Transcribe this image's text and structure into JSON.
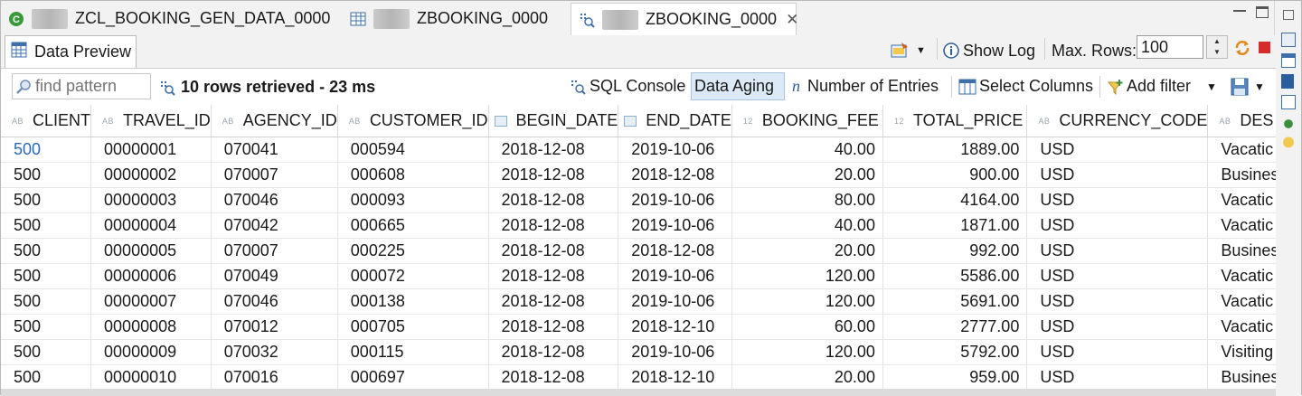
{
  "editor_tabs": [
    {
      "label": "ZCL_BOOKING_GEN_DATA_0000",
      "icon": "class-icon"
    },
    {
      "label": "ZBOOKING_0000",
      "icon": "table-icon"
    },
    {
      "label": "ZBOOKING_0000",
      "icon": "data-preview-icon"
    }
  ],
  "view": {
    "tab_label": "Data Preview",
    "show_log": "Show Log",
    "max_rows_label": "Max. Rows:",
    "max_rows_value": "100"
  },
  "toolbar": {
    "search_placeholder": "find pattern",
    "rows_message": "10 rows retrieved - 23 ms",
    "sql_console": "SQL Console",
    "data_aging": "Data Aging",
    "number_of_entries": "Number of Entries",
    "select_columns": "Select Columns",
    "add_filter": "Add filter"
  },
  "columns": [
    {
      "name": "CLIENT",
      "type": "AB"
    },
    {
      "name": "TRAVEL_ID",
      "type": "AB"
    },
    {
      "name": "AGENCY_ID",
      "type": "AB"
    },
    {
      "name": "CUSTOMER_ID",
      "type": "AB"
    },
    {
      "name": "BEGIN_DATE",
      "type": "date"
    },
    {
      "name": "END_DATE",
      "type": "date"
    },
    {
      "name": "BOOKING_FEE",
      "type": "12"
    },
    {
      "name": "TOTAL_PRICE",
      "type": "12"
    },
    {
      "name": "CURRENCY_CODE",
      "type": "AB"
    },
    {
      "name": "DES",
      "type": "AB"
    }
  ],
  "rows": [
    [
      "500",
      "00000001",
      "070041",
      "000594",
      "2018-12-08",
      "2019-10-06",
      "40.00",
      "1889.00",
      "USD",
      "Vacatic"
    ],
    [
      "500",
      "00000002",
      "070007",
      "000608",
      "2018-12-08",
      "2018-12-08",
      "20.00",
      "900.00",
      "USD",
      "Busines"
    ],
    [
      "500",
      "00000003",
      "070046",
      "000093",
      "2018-12-08",
      "2019-10-06",
      "80.00",
      "4164.00",
      "USD",
      "Vacatic"
    ],
    [
      "500",
      "00000004",
      "070042",
      "000665",
      "2018-12-08",
      "2019-10-06",
      "40.00",
      "1871.00",
      "USD",
      "Vacatic"
    ],
    [
      "500",
      "00000005",
      "070007",
      "000225",
      "2018-12-08",
      "2018-12-08",
      "20.00",
      "992.00",
      "USD",
      "Busines"
    ],
    [
      "500",
      "00000006",
      "070049",
      "000072",
      "2018-12-08",
      "2019-10-06",
      "120.00",
      "5586.00",
      "USD",
      "Vacatic"
    ],
    [
      "500",
      "00000007",
      "070046",
      "000138",
      "2018-12-08",
      "2019-10-06",
      "120.00",
      "5691.00",
      "USD",
      "Vacatic"
    ],
    [
      "500",
      "00000008",
      "070012",
      "000705",
      "2018-12-08",
      "2018-12-10",
      "60.00",
      "2777.00",
      "USD",
      "Vacatic"
    ],
    [
      "500",
      "00000009",
      "070032",
      "000115",
      "2018-12-08",
      "2019-10-06",
      "120.00",
      "5792.00",
      "USD",
      "Visiting"
    ],
    [
      "500",
      "00000010",
      "070016",
      "000697",
      "2018-12-08",
      "2018-12-10",
      "20.00",
      "959.00",
      "USD",
      "Busines"
    ]
  ],
  "colors": {
    "link": "#2a6ab8",
    "pressed_bg": "#dce9f7",
    "class_icon": "#3a9a3a"
  }
}
